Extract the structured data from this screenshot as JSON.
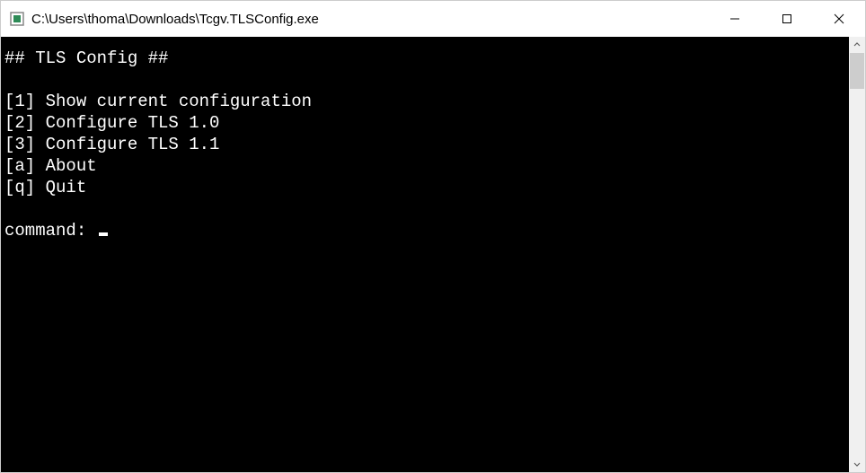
{
  "window": {
    "title": "C:\\Users\\thoma\\Downloads\\Tcgv.TLSConfig.exe"
  },
  "console": {
    "header": "## TLS Config ##",
    "menu": [
      {
        "key": "1",
        "label": "Show current configuration"
      },
      {
        "key": "2",
        "label": "Configure TLS 1.0"
      },
      {
        "key": "3",
        "label": "Configure TLS 1.1"
      },
      {
        "key": "a",
        "label": "About"
      },
      {
        "key": "q",
        "label": "Quit"
      }
    ],
    "prompt": "command: "
  }
}
